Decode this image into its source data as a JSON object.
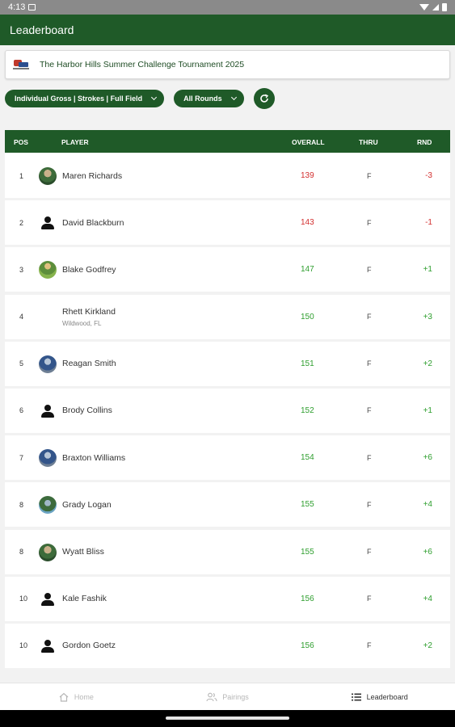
{
  "status_bar": {
    "time": "4:13"
  },
  "app_bar": {
    "title": "Leaderboard"
  },
  "tournament": {
    "title": "The Harbor Hills Summer Challenge Tournament 2025"
  },
  "filters": {
    "field_filter": "Individual Gross | Strokes | Full Field",
    "round_filter": "All Rounds"
  },
  "table": {
    "headers": {
      "pos": "POS",
      "player": "PLAYER",
      "overall": "OVERALL",
      "thru": "THRU",
      "rnd": "RND"
    },
    "rows": [
      {
        "pos": "1",
        "name": "Maren Richards",
        "location": "",
        "overall": "139",
        "thru": "F",
        "rnd": "-3",
        "avatar": "photo"
      },
      {
        "pos": "2",
        "name": "David Blackburn",
        "location": "",
        "overall": "143",
        "thru": "F",
        "rnd": "-1",
        "avatar": "person-icon"
      },
      {
        "pos": "3",
        "name": "Blake Godfrey",
        "location": "",
        "overall": "147",
        "thru": "F",
        "rnd": "+1",
        "avatar": "photo"
      },
      {
        "pos": "4",
        "name": "Rhett Kirkland",
        "location": "Wildwood, FL",
        "overall": "150",
        "thru": "F",
        "rnd": "+3",
        "avatar": "none"
      },
      {
        "pos": "5",
        "name": "Reagan Smith",
        "location": "",
        "overall": "151",
        "thru": "F",
        "rnd": "+2",
        "avatar": "photo"
      },
      {
        "pos": "6",
        "name": "Brody Collins",
        "location": "",
        "overall": "152",
        "thru": "F",
        "rnd": "+1",
        "avatar": "person-icon"
      },
      {
        "pos": "7",
        "name": "Braxton Williams",
        "location": "",
        "overall": "154",
        "thru": "F",
        "rnd": "+6",
        "avatar": "photo"
      },
      {
        "pos": "8",
        "name": "Grady Logan",
        "location": "",
        "overall": "155",
        "thru": "F",
        "rnd": "+4",
        "avatar": "photo"
      },
      {
        "pos": "8",
        "name": "Wyatt Bliss",
        "location": "",
        "overall": "155",
        "thru": "F",
        "rnd": "+6",
        "avatar": "photo"
      },
      {
        "pos": "10",
        "name": "Kale Fashik",
        "location": "",
        "overall": "156",
        "thru": "F",
        "rnd": "+4",
        "avatar": "person-icon"
      },
      {
        "pos": "10",
        "name": "Gordon Goetz",
        "location": "",
        "overall": "156",
        "thru": "F",
        "rnd": "+2",
        "avatar": "person-icon"
      }
    ]
  },
  "bottom_nav": {
    "home": "Home",
    "pairings": "Pairings",
    "leaderboard": "Leaderboard"
  },
  "colors": {
    "brand_green": "#1f5a28",
    "under_par_red": "#d32f2f",
    "over_par_green": "#2e9e2e"
  }
}
